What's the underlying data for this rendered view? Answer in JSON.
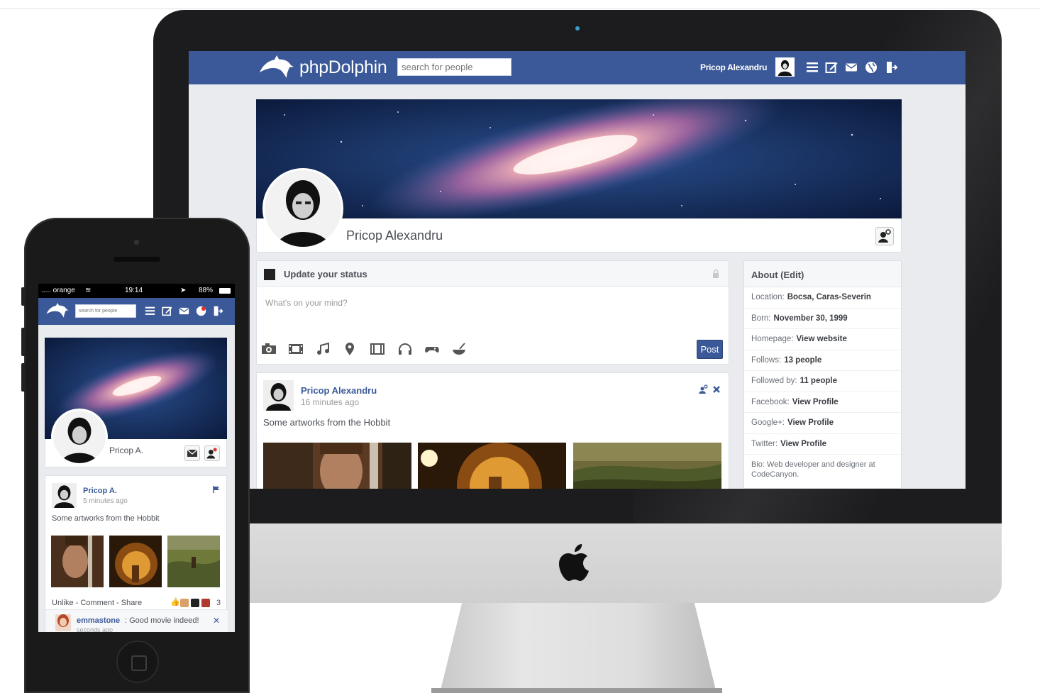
{
  "desktop": {
    "brand": "phpDolphin",
    "search_placeholder": "search for people",
    "nav_user": "Pricop Alexandru",
    "nav_icons": [
      "menu-icon",
      "edit-icon",
      "mail-icon",
      "globe-icon",
      "logout-icon"
    ],
    "profile_name": "Pricop Alexandru",
    "status": {
      "title": "Update your status",
      "placeholder": "What's on your mind?",
      "tools": [
        "camera-icon",
        "film-icon",
        "music-icon",
        "location-icon",
        "movie-icon",
        "headphones-icon",
        "gamepad-icon",
        "food-icon"
      ],
      "post_label": "Post"
    },
    "post": {
      "author": "Pricop Alexandru",
      "time": "16 minutes ago",
      "text": "Some artworks from the Hobbit"
    },
    "about": {
      "title": "About (Edit)",
      "rows": [
        {
          "label": "Location:",
          "value": "Bocsa, Caras-Severin"
        },
        {
          "label": "Born:",
          "value": "November 30, 1999"
        },
        {
          "label": "Homepage:",
          "value": "View website"
        },
        {
          "label": "Follows:",
          "value": "13 people"
        },
        {
          "label": "Followed by:",
          "value": "11 people"
        },
        {
          "label": "Facebook:",
          "value": "View Profile"
        },
        {
          "label": "Google+:",
          "value": "View Profile"
        },
        {
          "label": "Twitter:",
          "value": "View Profile"
        }
      ],
      "bio": "Bio: Web developer and designer at CodeCanyon."
    }
  },
  "mobile": {
    "carrier": "..... orange",
    "time": "19:14",
    "battery": "88%",
    "search_placeholder": "search for people",
    "profile_name": "Pricop A.",
    "post": {
      "author": "Pricop A.",
      "time": "5 minutes ago",
      "text": "Some artworks from the Hobbit",
      "actions": "Unlike - Comment - Share",
      "likes": "3"
    },
    "comment": {
      "user": "emmastone",
      "text": ": Good movie indeed!",
      "time": "seconds ago"
    }
  },
  "colors": {
    "brand_blue": "#3b5998",
    "page_bg": "#e9ebee"
  }
}
